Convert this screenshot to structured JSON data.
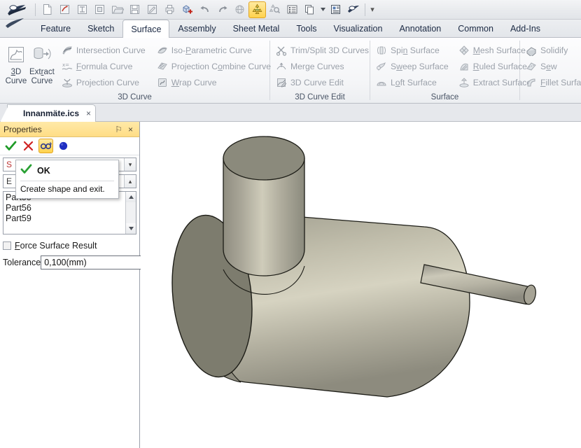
{
  "quick_access": {
    "items": [
      {
        "name": "new-document",
        "icon": "new-file-icon",
        "active": false
      },
      {
        "name": "new-part",
        "icon": "new-part-icon",
        "active": false
      },
      {
        "name": "new-drawing",
        "icon": "new-drawing-icon",
        "active": false
      },
      {
        "name": "new-assembly",
        "icon": "new-assembly-icon",
        "active": false
      },
      {
        "name": "open",
        "icon": "folder-open-icon",
        "active": false
      },
      {
        "name": "save",
        "icon": "floppy-save-icon",
        "active": false
      },
      {
        "name": "save-as",
        "icon": "save-as-icon",
        "active": false
      },
      {
        "name": "print-preview",
        "icon": "print-icon",
        "active": false
      },
      {
        "name": "new-3d-object",
        "icon": "add-cube-icon",
        "active": false
      },
      {
        "name": "undo",
        "icon": "undo-arrow-icon",
        "active": false
      },
      {
        "name": "redo",
        "icon": "redo-arrow-icon",
        "active": false
      },
      {
        "name": "globe-view",
        "icon": "globe-icon",
        "active": false
      },
      {
        "name": "assembly-tree",
        "icon": "tree-structure-icon",
        "active": true
      },
      {
        "name": "assembly-search",
        "icon": "tree-search-icon",
        "active": false
      },
      {
        "name": "list-view",
        "icon": "list-view-icon",
        "active": false
      },
      {
        "name": "copy-layers",
        "icon": "copy-layers-icon",
        "active": false
      },
      {
        "name": "properties-panel",
        "icon": "properties-icon",
        "active": false
      },
      {
        "name": "cad-tool",
        "icon": "cad-shape-icon",
        "active": false
      }
    ],
    "overflow_label": "▾"
  },
  "ribbon": {
    "tabs": [
      {
        "label": "Feature",
        "active": false
      },
      {
        "label": "Sketch",
        "active": false
      },
      {
        "label": "Surface",
        "active": true
      },
      {
        "label": "Assembly",
        "active": false
      },
      {
        "label": "Sheet Metal",
        "active": false
      },
      {
        "label": "Tools",
        "active": false
      },
      {
        "label": "Visualization",
        "active": false
      },
      {
        "label": "Annotation",
        "active": false
      },
      {
        "label": "Common",
        "active": false
      },
      {
        "label": "Add-Ins",
        "active": false
      }
    ],
    "groups": [
      {
        "label": "3D Curve",
        "big_buttons": [
          {
            "line1": "3D",
            "line2": "Curve",
            "icon": "3d-curve-icon"
          },
          {
            "line1": "Extract",
            "line2": "Curve",
            "icon": "extract-curve-icon"
          }
        ],
        "columns": [
          [
            {
              "label": "Intersection Curve",
              "icon": "intersection-curve-icon"
            },
            {
              "label": "Formula Curve",
              "icon": "formula-curve-icon"
            },
            {
              "label": "Projection Curve",
              "icon": "projection-curve-icon"
            }
          ],
          [
            {
              "label": "Iso-Parametric Curve",
              "icon": "iso-parametric-curve-icon"
            },
            {
              "label": "Projection Combine Curve",
              "icon": "projection-combine-curve-icon"
            },
            {
              "label": "Wrap Curve",
              "icon": "wrap-curve-icon"
            }
          ]
        ]
      },
      {
        "label": "3D Curve Edit",
        "big_buttons": [],
        "columns": [
          [
            {
              "label": "Trim/Split 3D Curves",
              "icon": "trim-split-icon"
            },
            {
              "label": "Merge Curves",
              "icon": "merge-curves-icon"
            },
            {
              "label": "3D Curve Edit",
              "icon": "3d-curve-edit-icon"
            }
          ]
        ]
      },
      {
        "label": "Surface",
        "big_buttons": [],
        "columns": [
          [
            {
              "label": "Spin Surface",
              "icon": "spin-surface-icon"
            },
            {
              "label": "Sweep Surface",
              "icon": "sweep-surface-icon"
            },
            {
              "label": "Loft Surface",
              "icon": "loft-surface-icon"
            }
          ],
          [
            {
              "label": "Mesh Surface",
              "icon": "mesh-surface-icon"
            },
            {
              "label": "Ruled Surface",
              "icon": "ruled-surface-icon"
            },
            {
              "label": "Extract Surface",
              "icon": "extract-surface-icon"
            }
          ]
        ]
      },
      {
        "label": "",
        "big_buttons": [],
        "columns": [
          [
            {
              "label": "Solidify",
              "icon": "solidify-icon"
            },
            {
              "label": "Sew",
              "icon": "sew-icon"
            },
            {
              "label": "Fillet Surfac",
              "icon": "fillet-surface-icon"
            }
          ]
        ]
      }
    ]
  },
  "document_tab": {
    "label": "Innanmäte.ics",
    "close_label": "×"
  },
  "properties": {
    "title": "Properties",
    "pin_label": "⚐",
    "close_label": "×",
    "toolbar": [
      {
        "name": "ok-check-button",
        "icon": "green-check-icon",
        "active": false
      },
      {
        "name": "cancel-button",
        "icon": "red-x-icon",
        "active": false
      },
      {
        "name": "preview-glasses-button",
        "icon": "glasses-icon",
        "active": true
      },
      {
        "name": "color-sphere-button",
        "icon": "blue-sphere-icon",
        "active": false
      }
    ],
    "combo_top": {
      "value": "S",
      "arrow": "▾"
    },
    "combo_second": {
      "value": "E",
      "arrow": "▴"
    },
    "list": {
      "items": [
        "Part55",
        "Part56",
        "Part59"
      ],
      "scroll_up": "▲",
      "scroll_down": "▼"
    },
    "force_surface_result": {
      "label": "Force Surface Result",
      "checked": false
    },
    "tolerance": {
      "label": "Tolerance",
      "value": "0,100(mm)"
    }
  },
  "tooltip": {
    "title": "OK",
    "body": "Create shape and exit.",
    "icon": "green-check-icon"
  },
  "viewport": {
    "background": "#ffffff",
    "model": {
      "name": "tee-shaped-solid",
      "face_dark": "#7d7d6f",
      "face_mid": "#9a9a8c",
      "face_light": "#c9c7b5",
      "outline": "#1c1c16"
    }
  }
}
